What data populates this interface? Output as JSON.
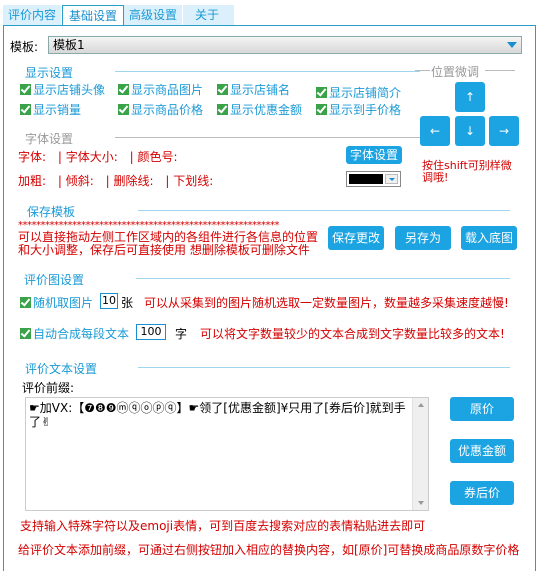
{
  "tabs": [
    {
      "label": "评价内容",
      "active": false
    },
    {
      "label": "基础设置",
      "active": true
    },
    {
      "label": "高级设置",
      "active": false
    },
    {
      "label": "关于",
      "active": false
    }
  ],
  "template": {
    "label": "模板:",
    "value": "模板1"
  },
  "display_settings": {
    "title": "显示设置",
    "checkboxes": [
      {
        "label": "显示店铺头像",
        "checked": true
      },
      {
        "label": "显示商品图片",
        "checked": true
      },
      {
        "label": "显示店铺名",
        "checked": true
      },
      {
        "label": "显示店铺简介",
        "checked": true
      },
      {
        "label": "显示销量",
        "checked": true
      },
      {
        "label": "显示商品价格",
        "checked": true
      },
      {
        "label": "显示优惠金额",
        "checked": true
      },
      {
        "label": "显示到手价格",
        "checked": true
      }
    ]
  },
  "position_adjust": {
    "title": "位置微调",
    "up": "↑",
    "down": "↓",
    "left": "←",
    "right": "→",
    "hint": "按住shift可别样微调哦!"
  },
  "font_settings": {
    "title": "字体设置",
    "row1": [
      "字体:",
      "|",
      "字体大小:",
      "|",
      "颜色号:"
    ],
    "row2": [
      "加粗:",
      "|",
      "倾斜:",
      "|",
      "删除线:",
      "|",
      "下划线:"
    ],
    "button": "字体设置",
    "color": "#000000"
  },
  "save_template": {
    "title": "保存模板",
    "stars": "**********************************************************",
    "desc1": "可以直接拖动左侧工作区域内的各组件进行各信息的位置",
    "desc2": "和大小调整，保存后可直接使用  想删除模板可删除文件",
    "buttons": [
      "保存更改",
      "另存为",
      "载入底图"
    ]
  },
  "image_settings": {
    "title": "评价图设置",
    "random": {
      "label": "随机取图片",
      "value": "10",
      "unit": "张",
      "hint": "可以从采集到的图片随机选取一定数量图片，数量越多采集速度越慢!"
    },
    "merge": {
      "label": "自动合成每段文本",
      "value": "100",
      "unit": "字",
      "hint": "可以将文字数量较少的文本合成到文字数量比较多的文本!"
    }
  },
  "text_settings": {
    "title": "评价文本设置",
    "prefix_label": "评价前缀:",
    "prefix_value": "  ☛加VX:【❼❽❾ⓜⓠⓞⓟⓠ】☛领了[优惠金额]¥只用了[券后价]就到手了✌",
    "buttons": [
      "原价",
      "优惠金额",
      "券后价"
    ],
    "hint1": "支持输入特殊字符以及emoji表情，可到百度去搜索对应的表情粘贴进去即可",
    "hint2": "给评价文本添加前缀，可通过右侧按钮加入相应的替换内容，如[原价]可替换成商品原数字价格"
  }
}
